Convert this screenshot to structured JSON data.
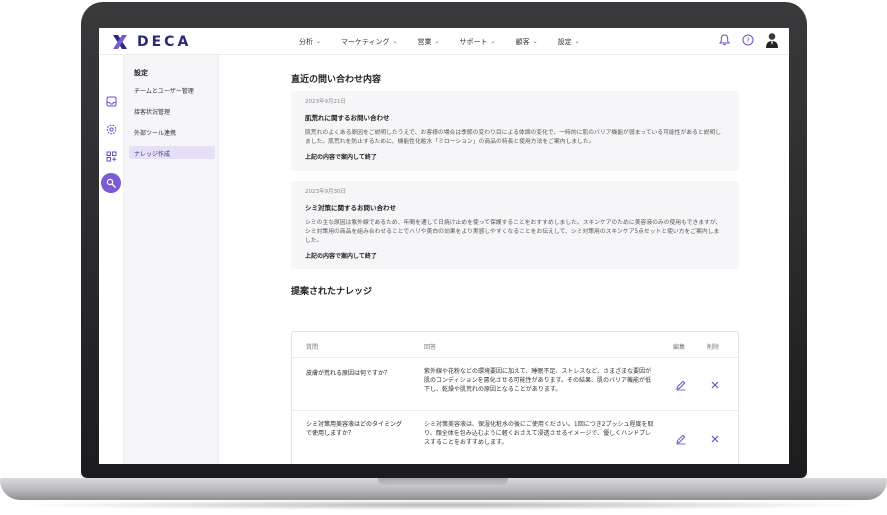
{
  "app": {
    "logo_text": "DECA",
    "brand_color": "#2b2a78",
    "accent_color": "#7c5ad6"
  },
  "nav": {
    "items": [
      {
        "label": "分析"
      },
      {
        "label": "マーケティング"
      },
      {
        "label": "営業"
      },
      {
        "label": "サポート"
      },
      {
        "label": "顧客"
      },
      {
        "label": "設定"
      }
    ],
    "right_icons": [
      "bell-icon",
      "help-circle-icon",
      "user-avatar"
    ]
  },
  "rail": {
    "icons": [
      "inbox-icon",
      "settings-gear-icon",
      "apps-add-icon",
      "wrench-icon"
    ],
    "active_index": 3
  },
  "submenu": {
    "title": "設定",
    "items": [
      {
        "label": "チームとユーザー管理"
      },
      {
        "label": "接客状況管理"
      },
      {
        "label": "外部ツール連携"
      },
      {
        "label": "ナレッジ作成"
      }
    ],
    "active_index": 3
  },
  "inquiries": {
    "section_title": "直近の問い合わせ内容",
    "items": [
      {
        "date": "2023年9月21日",
        "subject": "肌荒れに関するお問い合わせ",
        "body": "肌荒れのよくある原因をご説明したうえで、お客様の場合は季節の変わり目による体調の変化で、一時的に肌のバリア機能が弱まっている可能性があると説明しました。肌荒れを防止するために、機能性化粧水「ミローション」の商品の特長と使用方法をご案内しました。",
        "status": "上記の内容で案内して終了"
      },
      {
        "date": "2023年9月30日",
        "subject": "シミ対策に関するお問い合わせ",
        "body": "シミの主な原因は紫外線であるため、年間を通して日焼け止めを使って保護することをおすすめしました。スキンケアのために美容液のみの使用もできますが、シミ対策用の商品を組み合わせることでハリや美白の効果をより実感しやすくなることをお伝えして、シミ対策用のスキンケア5点セットと使い方をご案内しました。",
        "status": "上記の内容で案内して終了"
      }
    ]
  },
  "knowledge": {
    "section_title": "提案されたナレッジ",
    "columns": {
      "question": "質問",
      "answer": "回答",
      "edit": "編集",
      "delete": "削除"
    },
    "rows": [
      {
        "question": "皮膚が荒れる原因は何ですか？",
        "answer": "紫外線や花粉などの環境要因に加えて、睡眠不足、ストレスなど、さまざまな要因が肌のコンディションを悪化させる可能性があります。その結果、肌のバリア機能が低下し、乾燥や肌荒れの原因となることがあります。"
      },
      {
        "question": "シミ対策用美容液はどのタイミングで使用しますか？",
        "answer": "シミ対策美容液は、保湿化粧水の後にご使用ください。1回につき2プッシュ程度を取り、顔全体を包み込むように軽くおさえて浸透させるイメージで、優しくハンドプレスすることをおすすめします。"
      }
    ]
  }
}
